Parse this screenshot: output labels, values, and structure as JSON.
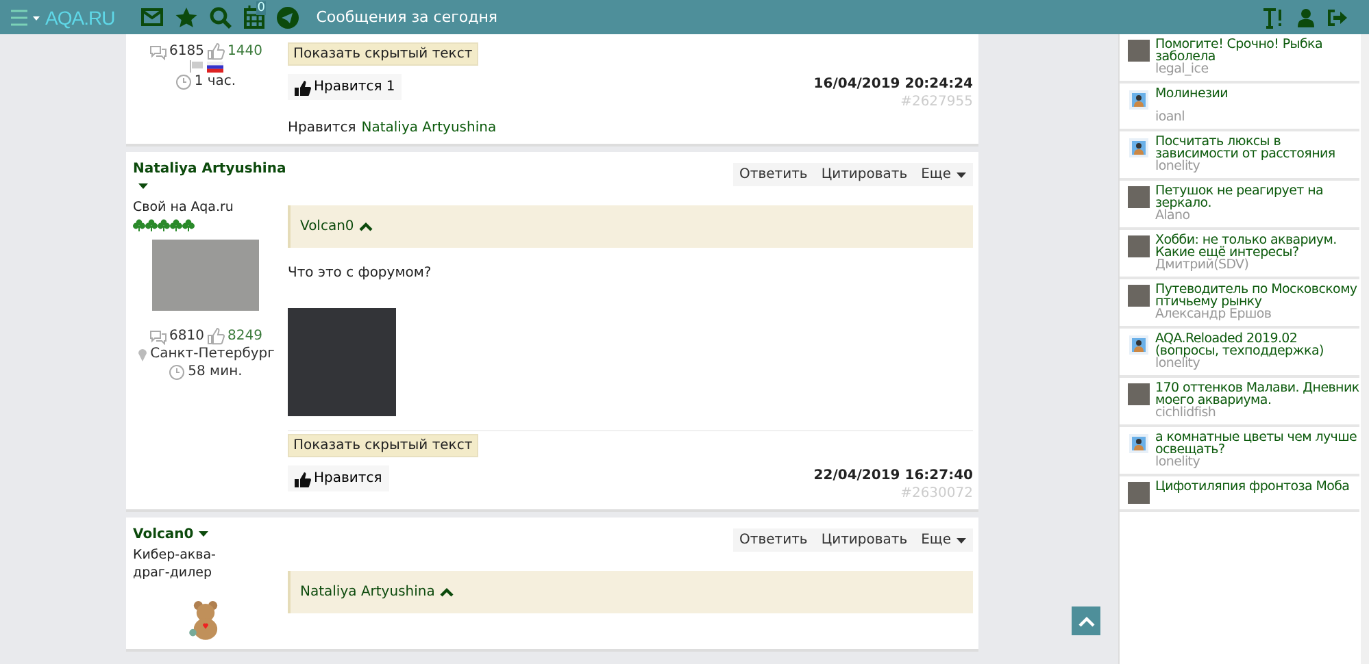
{
  "header": {
    "title": "Сообщения за сегодня",
    "logo": "AQA.RU",
    "calendar_badge": "0"
  },
  "posts": [
    {
      "messages": "6185",
      "likes": "1440",
      "last_seen": "1 час.",
      "flags": true,
      "hidden_text_button": "Показать скрытый текст",
      "like_button": "Нравится 1",
      "date": "16/04/2019 20:24:24",
      "post_id": "#2627955",
      "liked_by": {
        "label": "Нравится",
        "name": "Nataliya Artyushina"
      }
    },
    {
      "author": {
        "name": "Nataliya Artyushina",
        "rank": "Свой на Aqa.ru",
        "stars": 5
      },
      "avatar": {
        "kind": "photo"
      },
      "messages": "6810",
      "likes": "8249",
      "location": "Санкт-Петербург",
      "last_seen": "58 мин.",
      "actions": [
        "Ответить",
        "Цитировать",
        "Еще"
      ],
      "quote": {
        "author": "Volcan0",
        "expanded": true
      },
      "text": "Что это с форумом?",
      "image": true,
      "hidden_text_button": "Показать скрытый текст",
      "like_button": "Нравится",
      "date": "22/04/2019 16:27:40",
      "post_id": "#2630072"
    },
    {
      "author": {
        "name": "Volcan0",
        "rank": "Кибер-аква-драг-дилер"
      },
      "avatar": {
        "kind": "toy"
      },
      "actions": [
        "Ответить",
        "Цитировать",
        "Еще"
      ],
      "quote": {
        "author": "Nataliya Artyushina",
        "expanded": true
      }
    }
  ],
  "sidebar": {
    "topics": [
      {
        "title": "Помогите! Срочно! Рыбка заболела",
        "author": "legal_ice",
        "avatar": {
          "kind": "photo"
        }
      },
      {
        "title": "Молинезии",
        "author": "ioanl",
        "avatar": {
          "kind": "default"
        }
      },
      {
        "title": "Посчитать люксы в зависимости от расстояния",
        "author": "lonelity",
        "avatar": {
          "kind": "default"
        }
      },
      {
        "title": "Петушок не реагирует на зеркало.",
        "author": "Alano",
        "avatar": {
          "kind": "photo"
        }
      },
      {
        "title": "Хобби: не только аквариум. Какие ещё интересы?",
        "author": "Дмитрий(SDV)",
        "avatar": {
          "kind": "photo"
        }
      },
      {
        "title": "Путеводитель по Московскому птичьему рынку",
        "author": "Александр Ершов",
        "avatar": {
          "kind": "photo"
        }
      },
      {
        "title": "AQA.Reloaded 2019.02 (вопросы, техподдержка)",
        "author": "lonelity",
        "avatar": {
          "kind": "default"
        }
      },
      {
        "title": "170 оттенков Малави. Дневник моего аквариума.",
        "author": "cichlidfish",
        "avatar": {
          "kind": "photo"
        }
      },
      {
        "title": "а комнатные цветы чем лучше освещать?",
        "author": "lonelity",
        "avatar": {
          "kind": "default"
        }
      },
      {
        "title": "Цифотиляпия фронтоза Моба",
        "avatar": {
          "kind": "photo"
        }
      }
    ]
  }
}
